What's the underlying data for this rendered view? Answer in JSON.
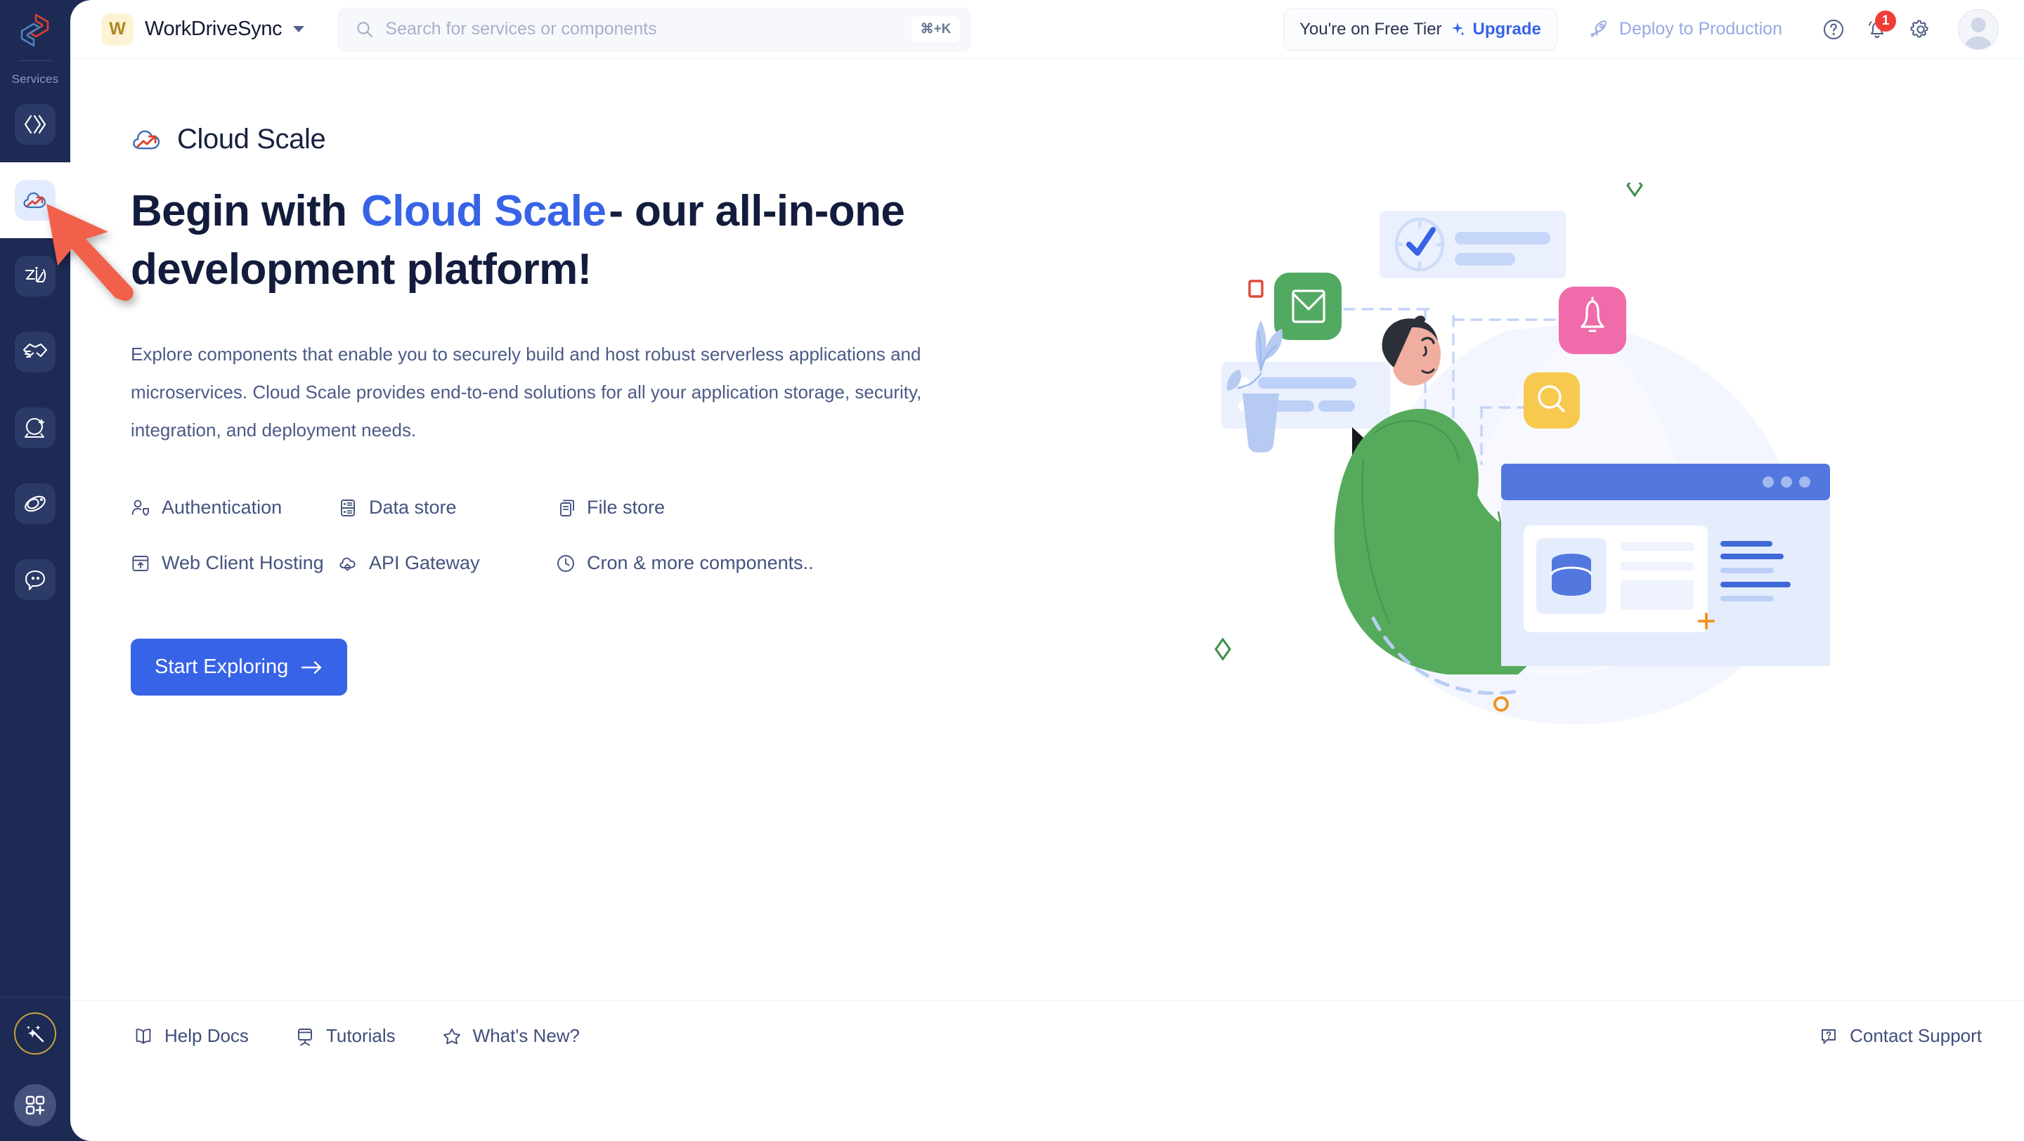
{
  "sidebar": {
    "section_label": "Services",
    "logo_icon": "app-logo-icon",
    "items": [
      {
        "icon": "code-brackets-icon",
        "name": "code-service",
        "active": false
      },
      {
        "icon": "cloud-scale-icon",
        "name": "cloud-scale-service",
        "active": true
      },
      {
        "icon": "zia-ai-icon",
        "name": "zia-service",
        "active": false
      },
      {
        "icon": "handshake-icon",
        "name": "integrations-service",
        "active": false
      },
      {
        "icon": "crystal-ball-icon",
        "name": "insights-service",
        "active": false
      },
      {
        "icon": "orbit-icon",
        "name": "orbit-service",
        "active": false
      },
      {
        "icon": "chat-bubble-icon",
        "name": "chat-service",
        "active": false
      }
    ],
    "bottom_items": [
      {
        "icon": "magic-wand-icon",
        "name": "magic-wand-button"
      },
      {
        "icon": "apps-grid-plus-icon",
        "name": "add-app-button"
      }
    ]
  },
  "header": {
    "org_initial": "W",
    "org_name": "WorkDriveSync",
    "org_caret_icon": "chevron-down-icon",
    "search": {
      "icon": "search-icon",
      "placeholder": "Search for services or components",
      "value": "",
      "shortcut": "⌘+K"
    },
    "tier_text": "You're on Free Tier",
    "upgrade_label": "Upgrade",
    "upgrade_icon": "sparkle-icon",
    "deploy_label": "Deploy to Production",
    "deploy_icon": "rocket-icon",
    "help_icon": "help-circle-icon",
    "notifications_icon": "bell-icon",
    "notifications_count": "1",
    "settings_icon": "gear-icon",
    "avatar_icon": "avatar"
  },
  "hero": {
    "brand_icon": "cloud-scale-icon",
    "brand_name": "Cloud Scale",
    "headline_before": "Begin with ",
    "headline_highlight": "Cloud Scale",
    "headline_after": "- our all-in-one development platform!",
    "description": "Explore components that enable you to securely build and host robust serverless applications and microservices. Cloud Scale provides end-to-end solutions for all your application storage, security, integration, and deployment needs.",
    "features": [
      {
        "label": "Authentication",
        "icon": "user-shield-icon"
      },
      {
        "label": "Data store",
        "icon": "database-rows-icon"
      },
      {
        "label": "File store",
        "icon": "file-stack-icon"
      },
      {
        "label": "Web Client Hosting",
        "icon": "browser-upload-icon"
      },
      {
        "label": "API Gateway",
        "icon": "cloud-gear-icon"
      },
      {
        "label": "Cron & more components..",
        "icon": "clock-icon"
      }
    ],
    "cta_label": "Start Exploring",
    "cta_icon": "arrow-right-icon"
  },
  "footer": {
    "links": [
      {
        "label": "Help Docs",
        "icon": "book-icon"
      },
      {
        "label": "Tutorials",
        "icon": "easel-icon"
      },
      {
        "label": "What's New?",
        "icon": "star-icon"
      }
    ],
    "support": {
      "label": "Contact Support",
      "icon": "question-bubble-icon"
    }
  },
  "annotation": {
    "type": "red-arrow",
    "points_to": "cloud-scale-service"
  },
  "colors": {
    "rail_bg": "#1d2a53",
    "accent_blue": "#3763e6",
    "highlight_yellow": "#f7d852",
    "badge_red": "#ef3e36",
    "text_dark": "#131c3c",
    "text_muted": "#4c5a86",
    "annotation_red": "#f0614b"
  }
}
